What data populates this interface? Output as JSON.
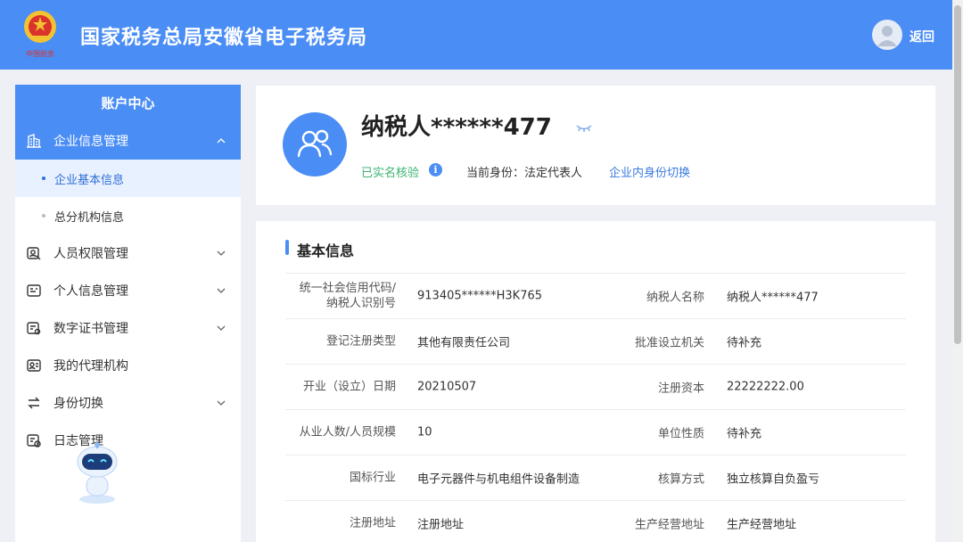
{
  "header": {
    "title": "国家税务总局安徽省电子税务局",
    "back_label": "返回",
    "emblem_caption": "中国税务"
  },
  "sidebar": {
    "title": "账户中心",
    "groups": [
      {
        "label": "企业信息管理",
        "icon": "building-icon",
        "expanded": true
      },
      {
        "label": "人员权限管理",
        "icon": "user-shield-icon"
      },
      {
        "label": "个人信息管理",
        "icon": "id-card-icon"
      },
      {
        "label": "数字证书管理",
        "icon": "certificate-icon"
      },
      {
        "label": "我的代理机构",
        "icon": "agency-icon"
      },
      {
        "label": "身份切换",
        "icon": "switch-icon"
      },
      {
        "label": "日志管理",
        "icon": "log-icon"
      }
    ],
    "subitems": [
      {
        "label": "企业基本信息",
        "selected": true
      },
      {
        "label": "总分机构信息",
        "selected": false
      }
    ]
  },
  "profile": {
    "name": "纳税人******477",
    "verified": "已实名核验",
    "identity": "当前身份：法定代表人",
    "switch_label": "企业内身份切换"
  },
  "basic_info": {
    "title": "基本信息",
    "rows": [
      {
        "label1": "统一社会信用代码/\n纳税人识别号",
        "value1": "913405******H3K765",
        "label2": "纳税人名称",
        "value2": "纳税人******477"
      },
      {
        "label1": "登记注册类型",
        "value1": "其他有限责任公司",
        "label2": "批准设立机关",
        "value2": "待补充"
      },
      {
        "label1": "开业（设立）日期",
        "value1": "20210507",
        "label2": "注册资本",
        "value2": "22222222.00"
      },
      {
        "label1": "从业人数/人员规模",
        "value1": "10",
        "label2": "单位性质",
        "value2": "待补充"
      },
      {
        "label1": "国标行业",
        "value1": "电子元器件与机电组件设备制造",
        "label2": "核算方式",
        "value2": "独立核算自负盈亏"
      },
      {
        "label1": "注册地址",
        "value1": "注册地址",
        "label2": "生产经营地址",
        "value2": "生产经营地址"
      }
    ]
  },
  "colors": {
    "primary": "#4a8df5",
    "verified": "#3cb371",
    "link": "#3a7be0",
    "selected_bg": "#e8f1ff"
  }
}
